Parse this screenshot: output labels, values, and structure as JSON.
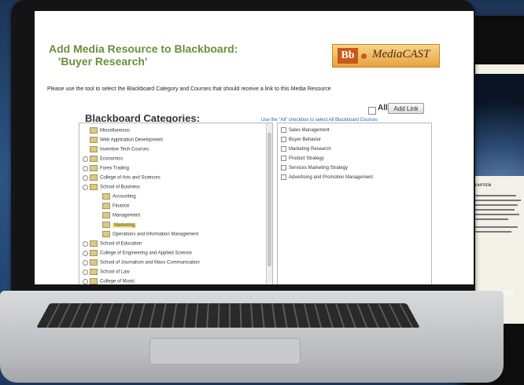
{
  "app": {
    "title_line1": "Add Media Resource to Blackboard:",
    "title_line2": "'Buyer Research'",
    "logo_bb": "Bb",
    "logo_text": "MediaCAST",
    "instructions": "Please use the tool to select the Blackboard Category and Courses that should receive a link to this Media Resource",
    "categories_heading": "Blackboard Categories:",
    "all_label": "All",
    "add_link_label": "Add Link",
    "all_hint": "Use the \"All\" checkbox to select All Blackboard Courses"
  },
  "categories": [
    {
      "label": "Miscellaneous",
      "level": 0,
      "expandable": false,
      "selected": false
    },
    {
      "label": "Web Application Development",
      "level": 0,
      "expandable": false,
      "selected": false
    },
    {
      "label": "Inventive Tech Courses",
      "level": 0,
      "expandable": false,
      "selected": false
    },
    {
      "label": "Economics",
      "level": 0,
      "expandable": true,
      "selected": false
    },
    {
      "label": "Forex Trading",
      "level": 0,
      "expandable": true,
      "selected": false
    },
    {
      "label": "College of Arts and Sciences",
      "level": 0,
      "expandable": true,
      "selected": false
    },
    {
      "label": "School of Business",
      "level": 0,
      "expandable": true,
      "selected": false
    },
    {
      "label": "Accounting",
      "level": 1,
      "expandable": false,
      "selected": false
    },
    {
      "label": "Finance",
      "level": 1,
      "expandable": false,
      "selected": false
    },
    {
      "label": "Management",
      "level": 1,
      "expandable": false,
      "selected": false
    },
    {
      "label": "Marketing",
      "level": 1,
      "expandable": false,
      "selected": true
    },
    {
      "label": "Operations and Information Management",
      "level": 1,
      "expandable": false,
      "selected": false
    },
    {
      "label": "School of Education",
      "level": 0,
      "expandable": true,
      "selected": false
    },
    {
      "label": "College of Engineering and Applied Science",
      "level": 0,
      "expandable": true,
      "selected": false
    },
    {
      "label": "School of Journalism and Mass Communication",
      "level": 0,
      "expandable": true,
      "selected": false
    },
    {
      "label": "School of Law",
      "level": 0,
      "expandable": true,
      "selected": false
    },
    {
      "label": "College of Music",
      "level": 0,
      "expandable": true,
      "selected": false
    }
  ],
  "courses": [
    "Sales Management",
    "Buyer Behavior",
    "Marketing Research",
    "Product Strategy",
    "Services Marketing Strategy",
    "Advertising and Promotion Management"
  ],
  "tablet": {
    "heading": "CHAPTER",
    "caption": "ipad ap"
  },
  "colors": {
    "title_green": "#6a8f3a",
    "hint_blue": "#2a62b5",
    "selected_highlight": "#f4e27a",
    "logo_orange": "#e8a23f"
  }
}
